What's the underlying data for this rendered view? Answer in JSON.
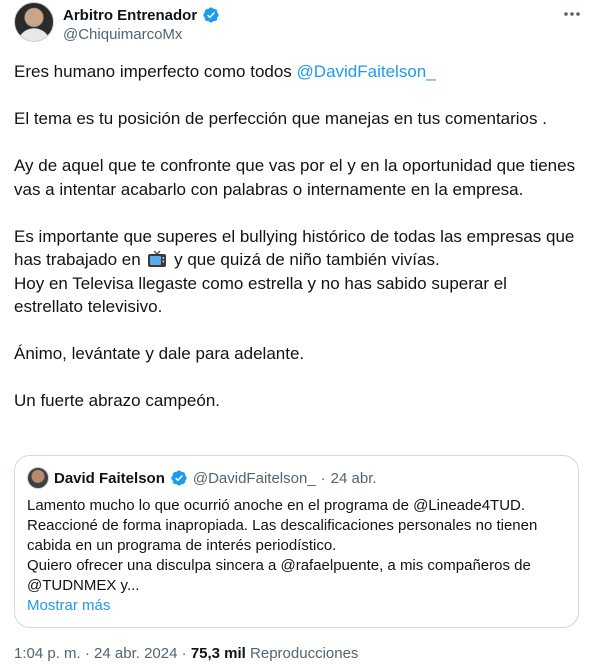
{
  "author": {
    "name": "Arbitro Entrenador",
    "handle": "@ChiquimarcoMx"
  },
  "tweet": {
    "p1_text": "Eres humano imperfecto como todos ",
    "p1_mention": "@DavidFaitelson_",
    "p2": "El tema es tu posición de perfección que manejas en tus comentarios .",
    "p3": "Ay de aquel que te confronte que vas por el y en la oportunidad que tienes vas a intentar acabarlo con palabras o internamente en la empresa.",
    "p4_a": "Es importante que superes el bullying histórico de todas las empresas que has trabajado  en ",
    "p4_b": " y que quizá de niño también vivías.",
    "p4_c": "Hoy en Televisa llegaste como estrella y no has sabido superar el estrellato televisivo.",
    "p5": "Ánimo, levántate y dale para adelante.",
    "p6": "Un fuerte abrazo campeón."
  },
  "quote": {
    "name": "David Faitelson",
    "handle": "@DavidFaitelson_",
    "separator": "·",
    "date": "24 abr.",
    "line1": "Lamento mucho lo que ocurrió anoche en el programa de @Lineade4TUD.",
    "line2": "Reaccioné de forma inapropiada. Las descalificaciones personales no tienen cabida en un programa de interés periodístico.",
    "line3": "Quiero ofrecer una disculpa sincera a  @rafaelpuente, a mis compañeros de @TUDNMEX y...",
    "show_more": "Mostrar más"
  },
  "meta": {
    "time": "1:04 p. m.",
    "sep1": "·",
    "date": "24 abr. 2024",
    "sep2": "·",
    "views": "75,3 mil",
    "views_label": "Reproducciones"
  },
  "colors": {
    "accent": "#1d9bf0",
    "text": "#0f1419",
    "muted": "#536471",
    "border": "#cfd9de"
  },
  "icons": [
    "verified-badge-icon",
    "more-options-icon",
    "television-emoji-icon"
  ]
}
